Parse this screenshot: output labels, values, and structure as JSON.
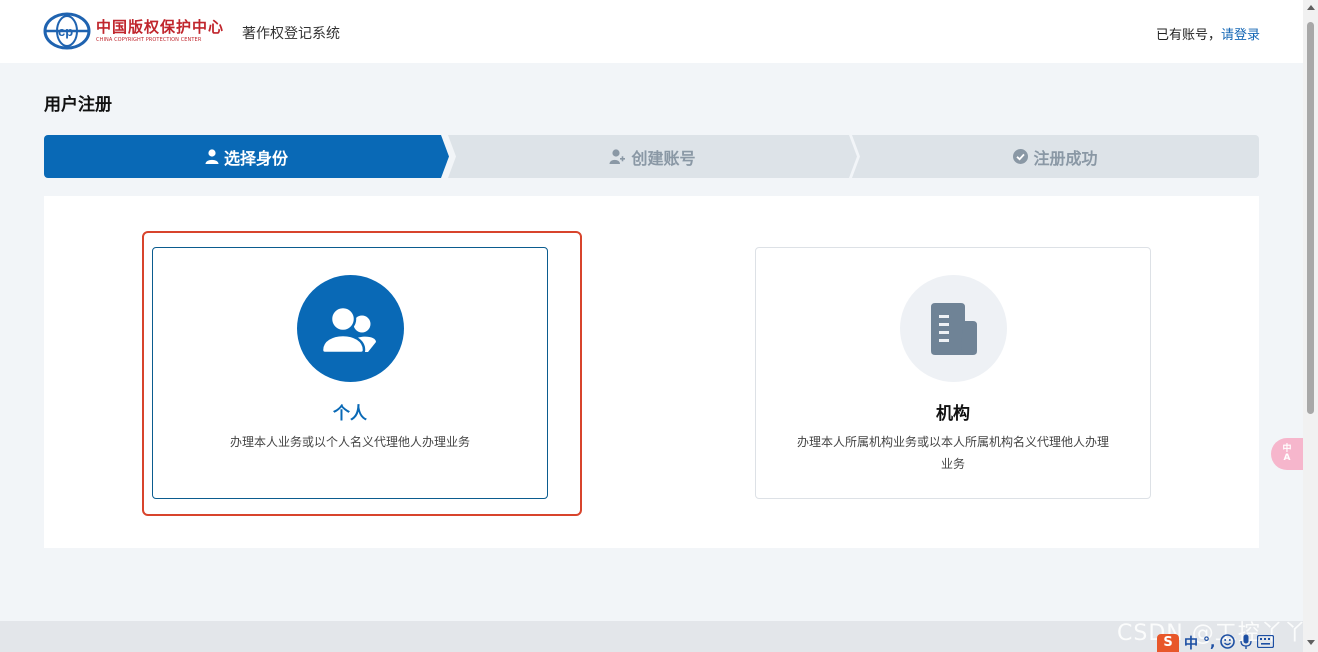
{
  "header": {
    "logo_cn": "中国版权保护中心",
    "logo_en": "CHINA COPYRIGHT PROTECTION CENTER",
    "system_title": "著作权登记系统",
    "has_account_text": "已有账号，",
    "login_link": "请登录"
  },
  "page": {
    "title": "用户注册"
  },
  "steps": [
    {
      "label": "选择身份",
      "icon": "user-icon",
      "state": "active"
    },
    {
      "label": "创建账号",
      "icon": "user-add-icon",
      "state": "inactive"
    },
    {
      "label": "注册成功",
      "icon": "check-circle-icon",
      "state": "inactive"
    }
  ],
  "cards": {
    "personal": {
      "title": "个人",
      "desc": "办理本人业务或以个人名义代理他人办理业务",
      "icon": "users-icon"
    },
    "org": {
      "title": "机构",
      "desc": "办理本人所属机构业务或以本人所属机构名义代理他人办理业务",
      "icon": "document-icon"
    }
  },
  "floating": {
    "translate_label": "中\nA"
  },
  "watermark": "CSDN @工控丫丫",
  "ime": {
    "logo": "S",
    "mode": "中",
    "punct": "°,"
  },
  "colors": {
    "primary": "#0969b6",
    "step_inactive": "#dde3e8",
    "highlight": "#d8442c",
    "brand_red": "#c0262d"
  }
}
